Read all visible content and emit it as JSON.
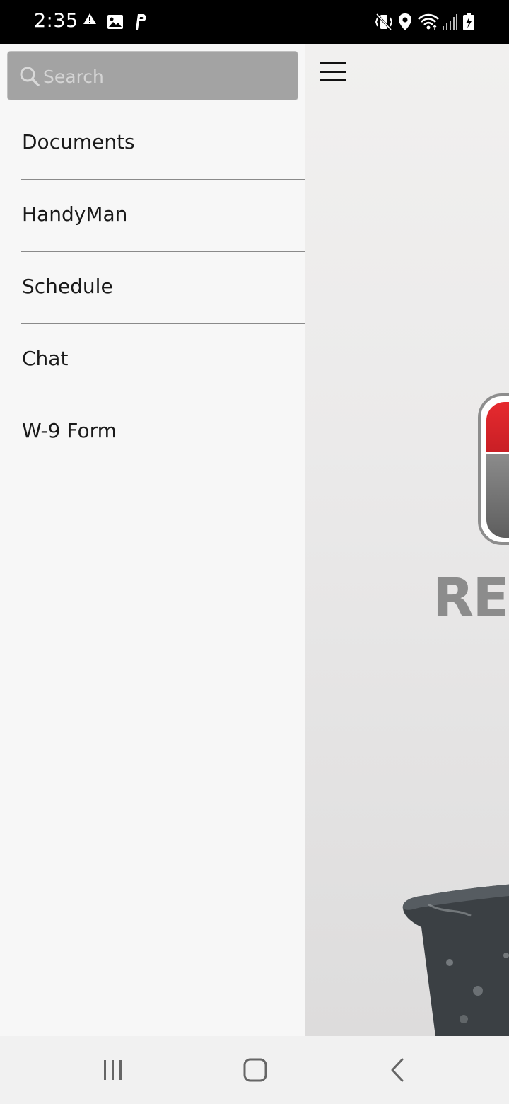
{
  "status_bar": {
    "time": "2:35",
    "left_icons": [
      "alert-mm-icon",
      "image-icon",
      "parking-icon"
    ],
    "right_icons": [
      "vibrate-icon",
      "location-icon",
      "wifi-icon",
      "signal-icon",
      "battery-charging-icon"
    ]
  },
  "drawer": {
    "search": {
      "placeholder": "Search",
      "value": ""
    },
    "items": [
      {
        "label": "Documents"
      },
      {
        "label": "HandyMan"
      },
      {
        "label": "Schedule"
      },
      {
        "label": "Chat"
      },
      {
        "label": "W-9 Form"
      }
    ]
  },
  "main": {
    "logo_text": "RE",
    "colors": {
      "logo_red": "#e62a2f",
      "logo_grey": "#8c8c8c"
    }
  },
  "nav_bar": {
    "buttons": [
      "recent-apps-icon",
      "home-icon",
      "back-icon"
    ]
  }
}
